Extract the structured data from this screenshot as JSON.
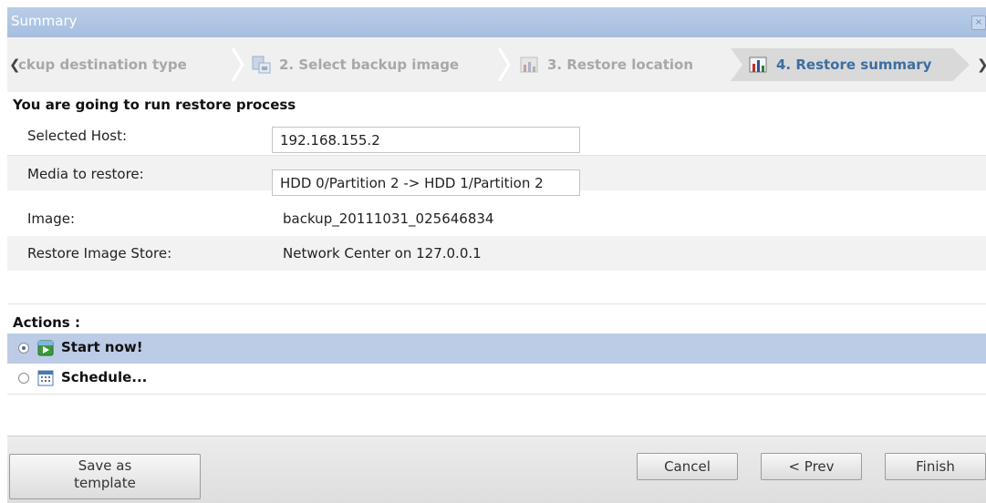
{
  "window": {
    "title": "Summary",
    "close_label": "×"
  },
  "wizard": {
    "steps": [
      {
        "label": "ckup destination type",
        "state": "done"
      },
      {
        "label": "2. Select backup image",
        "state": "done"
      },
      {
        "label": "3. Restore location",
        "state": "done"
      },
      {
        "label": "4. Restore summary",
        "state": "active"
      }
    ],
    "scroll_left": "❮",
    "scroll_right": "❯"
  },
  "summary": {
    "heading": "You are going to run restore process",
    "fields": [
      {
        "label": "Selected Host:",
        "value": "192.168.155.2"
      },
      {
        "label": "Media to restore:",
        "value": "HDD 0/Partition 2 -> HDD 1/Partition 2"
      },
      {
        "label": "Image:",
        "value": "backup_20111031_025646834"
      },
      {
        "label": "Restore Image Store:",
        "value": "Network Center on 127.0.0.1"
      }
    ]
  },
  "actions": {
    "heading": "Actions :",
    "options": [
      {
        "label": "Start now!",
        "icon": "play-icon",
        "selected": true
      },
      {
        "label": "Schedule...",
        "icon": "calendar-icon",
        "selected": false
      }
    ]
  },
  "footer": {
    "save_template_line1": "Save as",
    "save_template_line2": "template",
    "cancel": "Cancel",
    "prev": "< Prev",
    "finish": "Finish"
  },
  "colors": {
    "titlebar": "#a6bedf",
    "active_step_text": "#3c6ea1",
    "selected_row": "#bccce6"
  }
}
